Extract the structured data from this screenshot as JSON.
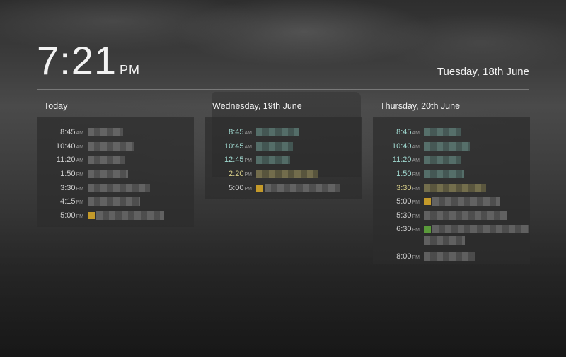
{
  "clock": {
    "time": "7:21",
    "ampm": "PM"
  },
  "current_date": "Tuesday, 18th June",
  "days": [
    {
      "title": "Today",
      "events": [
        {
          "time": "8:45",
          "suffix": "AM",
          "color": "white",
          "blob_width": 50
        },
        {
          "time": "10:40",
          "suffix": "AM",
          "color": "white",
          "blob_width": 66
        },
        {
          "time": "11:20",
          "suffix": "AM",
          "color": "white",
          "blob_width": 52
        },
        {
          "time": "1:50",
          "suffix": "PM",
          "color": "white",
          "blob_width": 57
        },
        {
          "time": "3:30",
          "suffix": "PM",
          "color": "white",
          "blob_width": 88
        },
        {
          "time": "4:15",
          "suffix": "PM",
          "color": "white",
          "blob_width": 74
        },
        {
          "time": "5:00",
          "suffix": "PM",
          "color": "white",
          "chip": "#c49a2a",
          "blob_width": 96
        }
      ]
    },
    {
      "title": "Wednesday, 19th June",
      "events": [
        {
          "time": "8:45",
          "suffix": "AM",
          "color": "teal",
          "blob_width": 60
        },
        {
          "time": "10:45",
          "suffix": "AM",
          "color": "teal",
          "blob_width": 52
        },
        {
          "time": "12:45",
          "suffix": "PM",
          "color": "teal",
          "blob_width": 48
        },
        {
          "time": "2:20",
          "suffix": "PM",
          "color": "yellow",
          "blob_width": 88
        },
        {
          "time": "5:00",
          "suffix": "PM",
          "color": "white",
          "chip": "#c49a2a",
          "blob_width": 106
        }
      ]
    },
    {
      "title": "Thursday, 20th June",
      "events": [
        {
          "time": "8:45",
          "suffix": "AM",
          "color": "teal",
          "blob_width": 52
        },
        {
          "time": "10:40",
          "suffix": "AM",
          "color": "teal",
          "blob_width": 66
        },
        {
          "time": "11:20",
          "suffix": "AM",
          "color": "teal",
          "blob_width": 52
        },
        {
          "time": "1:50",
          "suffix": "PM",
          "color": "teal",
          "blob_width": 57
        },
        {
          "time": "3:30",
          "suffix": "PM",
          "color": "yellow",
          "blob_width": 88
        },
        {
          "time": "5:00",
          "suffix": "PM",
          "color": "white",
          "chip": "#c49a2a",
          "blob_width": 96
        },
        {
          "time": "5:30",
          "suffix": "PM",
          "color": "white",
          "blob_width": 118
        },
        {
          "time": "6:30",
          "suffix": "PM",
          "color": "white",
          "chip": "#5a9a3a",
          "blob_width": 136,
          "blob_width2": 58
        },
        {
          "time": "8:00",
          "suffix": "PM",
          "color": "white",
          "blob_width": 72
        }
      ]
    }
  ]
}
